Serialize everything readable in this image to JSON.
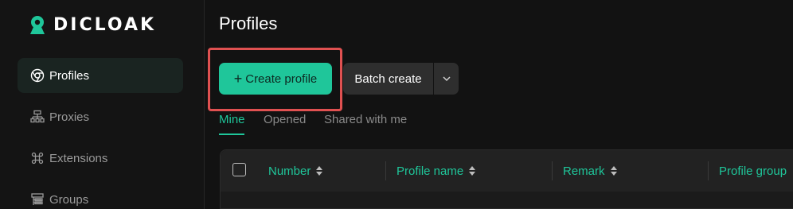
{
  "app": {
    "brand": "DICLOAK",
    "colors": {
      "accent": "#1fc69a",
      "highlight": "#e05151",
      "background": "#121212"
    }
  },
  "sidebar": {
    "items": [
      {
        "label": "Profiles",
        "icon": "chrome-icon",
        "active": true
      },
      {
        "label": "Proxies",
        "icon": "network-icon",
        "active": false
      },
      {
        "label": "Extensions",
        "icon": "command-icon",
        "active": false
      },
      {
        "label": "Groups",
        "icon": "groups-icon",
        "active": false
      }
    ]
  },
  "main": {
    "title": "Profiles",
    "toolbar": {
      "create_icon": "+",
      "create_label": "Create profile",
      "batch_label": "Batch create"
    },
    "tabs": [
      {
        "label": "Mine",
        "active": true
      },
      {
        "label": "Opened",
        "active": false
      },
      {
        "label": "Shared with me",
        "active": false
      }
    ],
    "table": {
      "columns": [
        "Number",
        "Profile name",
        "Remark",
        "Profile group"
      ]
    }
  }
}
